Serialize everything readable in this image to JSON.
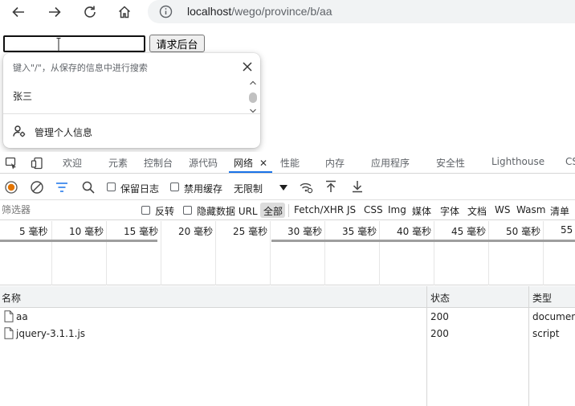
{
  "browser": {
    "url_host": "localhost",
    "url_path": "/wego/province/b/aa"
  },
  "page": {
    "input_value": "",
    "button_label": "请求后台"
  },
  "autofill": {
    "hint": "键入\"/\"，从保存的信息中进行搜索",
    "suggestion": "张三",
    "manage_label": "管理个人信息"
  },
  "devtools": {
    "tabs": [
      {
        "label": "欢迎"
      },
      {
        "label": "元素"
      },
      {
        "label": "控制台"
      },
      {
        "label": "源代码"
      },
      {
        "label": "网络",
        "active": true
      },
      {
        "label": "性能"
      },
      {
        "label": "内存"
      },
      {
        "label": "应用程序"
      },
      {
        "label": "安全性"
      },
      {
        "label": "Lighthouse"
      },
      {
        "label": "CS"
      }
    ],
    "toolbar": {
      "preserve_log": "保留日志",
      "disable_cache": "禁用缓存",
      "throttle": "无限制"
    },
    "filter": {
      "placeholder": "筛选器",
      "invert": "反转",
      "hide_data_urls": "隐藏数据 URL",
      "types": [
        "全部",
        "Fetch/XHR",
        "JS",
        "CSS",
        "Img",
        "媒体",
        "字体",
        "文档",
        "WS",
        "Wasm",
        "清单"
      ]
    },
    "timeline": {
      "ticks": [
        "5 毫秒",
        "10 毫秒",
        "15 毫秒",
        "20 毫秒",
        "25 毫秒",
        "30 毫秒",
        "35 毫秒",
        "40 毫秒",
        "45 毫秒",
        "50 毫秒",
        "55"
      ]
    },
    "table": {
      "headers": {
        "name": "名称",
        "status": "状态",
        "type": "类型"
      },
      "rows": [
        {
          "name": "aa",
          "status": "200",
          "type": "document"
        },
        {
          "name": "jquery-3.1.1.js",
          "status": "200",
          "type": "script"
        }
      ]
    }
  }
}
